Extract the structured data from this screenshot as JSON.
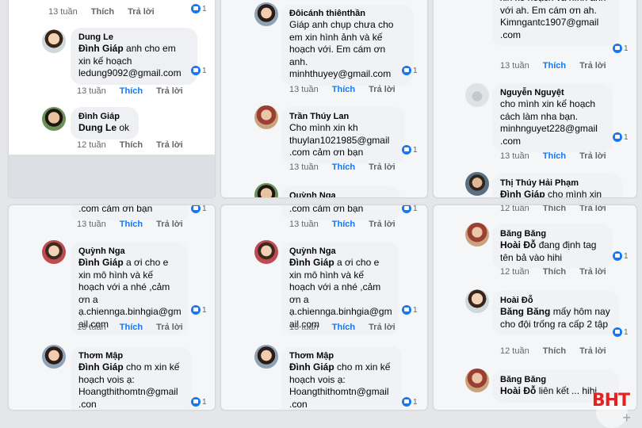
{
  "panels": [
    {
      "id": "p1",
      "comments": [
        {
          "actions": {
            "time": "13 tuần",
            "like": "Thích",
            "reply": "Trả lời",
            "like_active": false
          },
          "reacts": "1"
        },
        {
          "name": "Dung Le",
          "text": "anh cho em xin kế hoạch ledung9092@gmail.com",
          "tag": "Đình Giáp",
          "actions": {
            "time": "13 tuần",
            "like": "Thích",
            "reply": "Trả lời",
            "like_active": true
          },
          "reacts": "1"
        },
        {
          "name": "Đình Giáp",
          "text": "ok",
          "tag": "Dung Le",
          "actions": {
            "time": "12 tuần",
            "like": "Thích",
            "reply": "Trả lời",
            "like_active": false
          }
        }
      ]
    },
    {
      "id": "p2",
      "comments": [
        {
          "name": "Đôicánh thiênthần",
          "text": "Giáp anh chụp chưa cho em xin hình ảnh và kế hoạch với. Em cám ơn anh. minhthuyey@gmail.com",
          "actions": {
            "time": "13 tuần",
            "like": "Thích",
            "reply": "Trả lời",
            "like_active": true
          },
          "reacts": "1"
        },
        {
          "name": "Trần Thúy Lan",
          "text": "Cho mình xin kh thuylan1021985@gmail .com cảm ơn bạn",
          "actions": {
            "time": "13 tuần",
            "like": "Thích",
            "reply": "Trả lời",
            "like_active": true
          },
          "reacts": "1"
        },
        {
          "name": "Quỳnh Nga"
        }
      ]
    },
    {
      "id": "p3",
      "comments": [
        {
          "text": "xin kế hoạch và hình ảnh với ah. Em cám ơn ah. Kimngantc1907@gmail .com",
          "actions": {
            "time": "13 tuần",
            "like": "Thích",
            "reply": "Trả lời",
            "like_active": true
          },
          "reacts": "1"
        },
        {
          "name": "Nguyễn Nguyệt",
          "text": "cho mình xin kế hoạch cách làm nha bạn. minhnguyet228@gmail .com",
          "actions": {
            "time": "13 tuần",
            "like": "Thích",
            "reply": "Trả lời",
            "like_active": true
          },
          "reacts": "1"
        },
        {
          "name": "Thị Thúy Hải Phạm",
          "tag": "Đình Giáp",
          "text": "cho mình xin"
        }
      ]
    },
    {
      "id": "p4",
      "comments": [
        {
          "text": ".com cảm ơn bạn",
          "actions": {
            "time": "13 tuần",
            "like": "Thích",
            "reply": "Trả lời",
            "like_active": true
          },
          "reacts": "1"
        },
        {
          "name": "Quỳnh Nga",
          "tag": "Đình Giáp",
          "text": "a ơi cho e xin mô hình và kế hoạch với a nhé ,cảm ơn a ạ.chiennga.binhgia@gm ail.com",
          "actions": {
            "time": "13 tuần",
            "like": "Thích",
            "reply": "Trả lời",
            "like_active": true
          },
          "reacts": "1"
        },
        {
          "name": "Thơm Mập",
          "tag": "Đình Giáp",
          "text": "cho m xin kế hoạch vois ạ: Hoangthithomtn@gmail .con",
          "reacts": "1"
        }
      ]
    },
    {
      "id": "p5",
      "comments": [
        {
          "text": ".com cảm ơn bạn",
          "actions": {
            "time": "13 tuần",
            "like": "Thích",
            "reply": "Trả lời",
            "like_active": true
          },
          "reacts": "1"
        },
        {
          "name": "Quỳnh Nga",
          "tag": "Đình Giáp",
          "text": "a ơi cho e xin mô hình và kế hoạch với a nhé ,cảm ơn a ạ.chiennga.binhgia@gm ail.com",
          "actions": {
            "time": "13 tuần",
            "like": "Thích",
            "reply": "Trả lời",
            "like_active": true
          },
          "reacts": "1"
        },
        {
          "name": "Thơm Mập",
          "tag": "Đình Giáp",
          "text": "cho m xin kế hoạch vois ạ: Hoangthithomtn@gmail .con",
          "reacts": "1"
        }
      ]
    },
    {
      "id": "p6",
      "comments": [
        {
          "actions": {
            "time": "12 tuần",
            "like": "Thích",
            "reply": "Trả lời",
            "like_active": false
          }
        },
        {
          "name": "Băng Băng",
          "tag": "Hoài Đỗ",
          "text": "đang định tag tên bả vào hihi",
          "actions": {
            "time": "12 tuần",
            "like": "Thích",
            "reply": "Trả lời",
            "like_active": false
          },
          "reacts": "1"
        },
        {
          "name": "Hoài Đỗ",
          "tag": "Băng Băng",
          "text": "mấy hôm nay cho đội trống ra cấp 2 tập",
          "actions": {
            "time": "12 tuần",
            "like": "Thích",
            "reply": "Trả lời",
            "like_active": false
          },
          "reacts": "1"
        },
        {
          "name": "Băng Băng",
          "tag": "Hoài Đỗ",
          "text": "liên kết ... hihi"
        }
      ]
    }
  ],
  "watermark": "BHT"
}
